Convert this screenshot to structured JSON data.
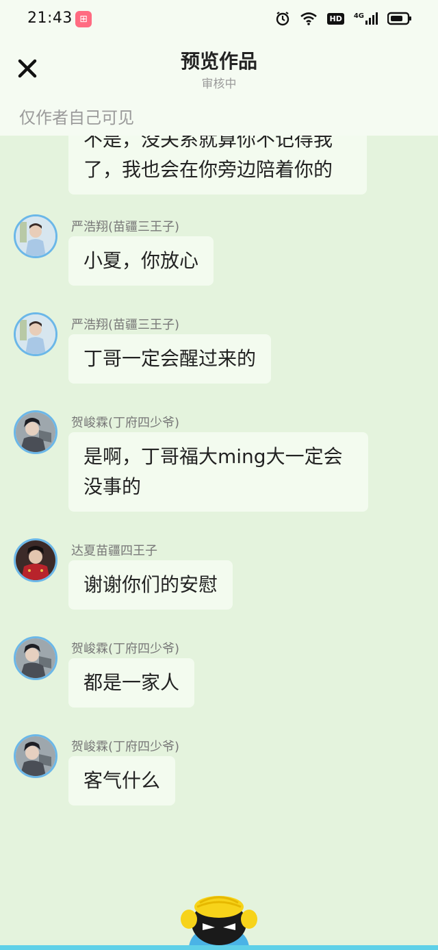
{
  "status_bar": {
    "time": "21:43",
    "app_badge_icon": "app-notification-icon",
    "hd_label": "HD",
    "network_label": "4G"
  },
  "header": {
    "title": "预览作品",
    "subtitle": "审核中",
    "visibility_note": "仅作者自己可见"
  },
  "top_message": {
    "text": "不是，没关系就算你不记得我了，我也会在你旁边陪着你的"
  },
  "messages": [
    {
      "sender": "严浩翔(苗疆三王子)",
      "text": "小夏，你放心",
      "avatar": "avatar-yan-icon"
    },
    {
      "sender": "严浩翔(苗疆三王子)",
      "text": "丁哥一定会醒过来的",
      "avatar": "avatar-yan-icon"
    },
    {
      "sender": "贺峻霖(丁府四少爷)",
      "text": "是啊，丁哥福大ming大一定会没事的",
      "avatar": "avatar-he-icon"
    },
    {
      "sender": "达夏苗疆四王子",
      "text": "谢谢你们的安慰",
      "avatar": "avatar-da-icon"
    },
    {
      "sender": "贺峻霖(丁府四少爷)",
      "text": "都是一家人",
      "avatar": "avatar-he-icon"
    },
    {
      "sender": "贺峻霖(丁府四少爷)",
      "text": "客气什么",
      "avatar": "avatar-he-icon"
    }
  ],
  "colors": {
    "background": "#e4f3dd",
    "bubble": "#f3fbef",
    "avatar_ring": "#6bb7e8",
    "accent_line": "#5fd0e8"
  }
}
